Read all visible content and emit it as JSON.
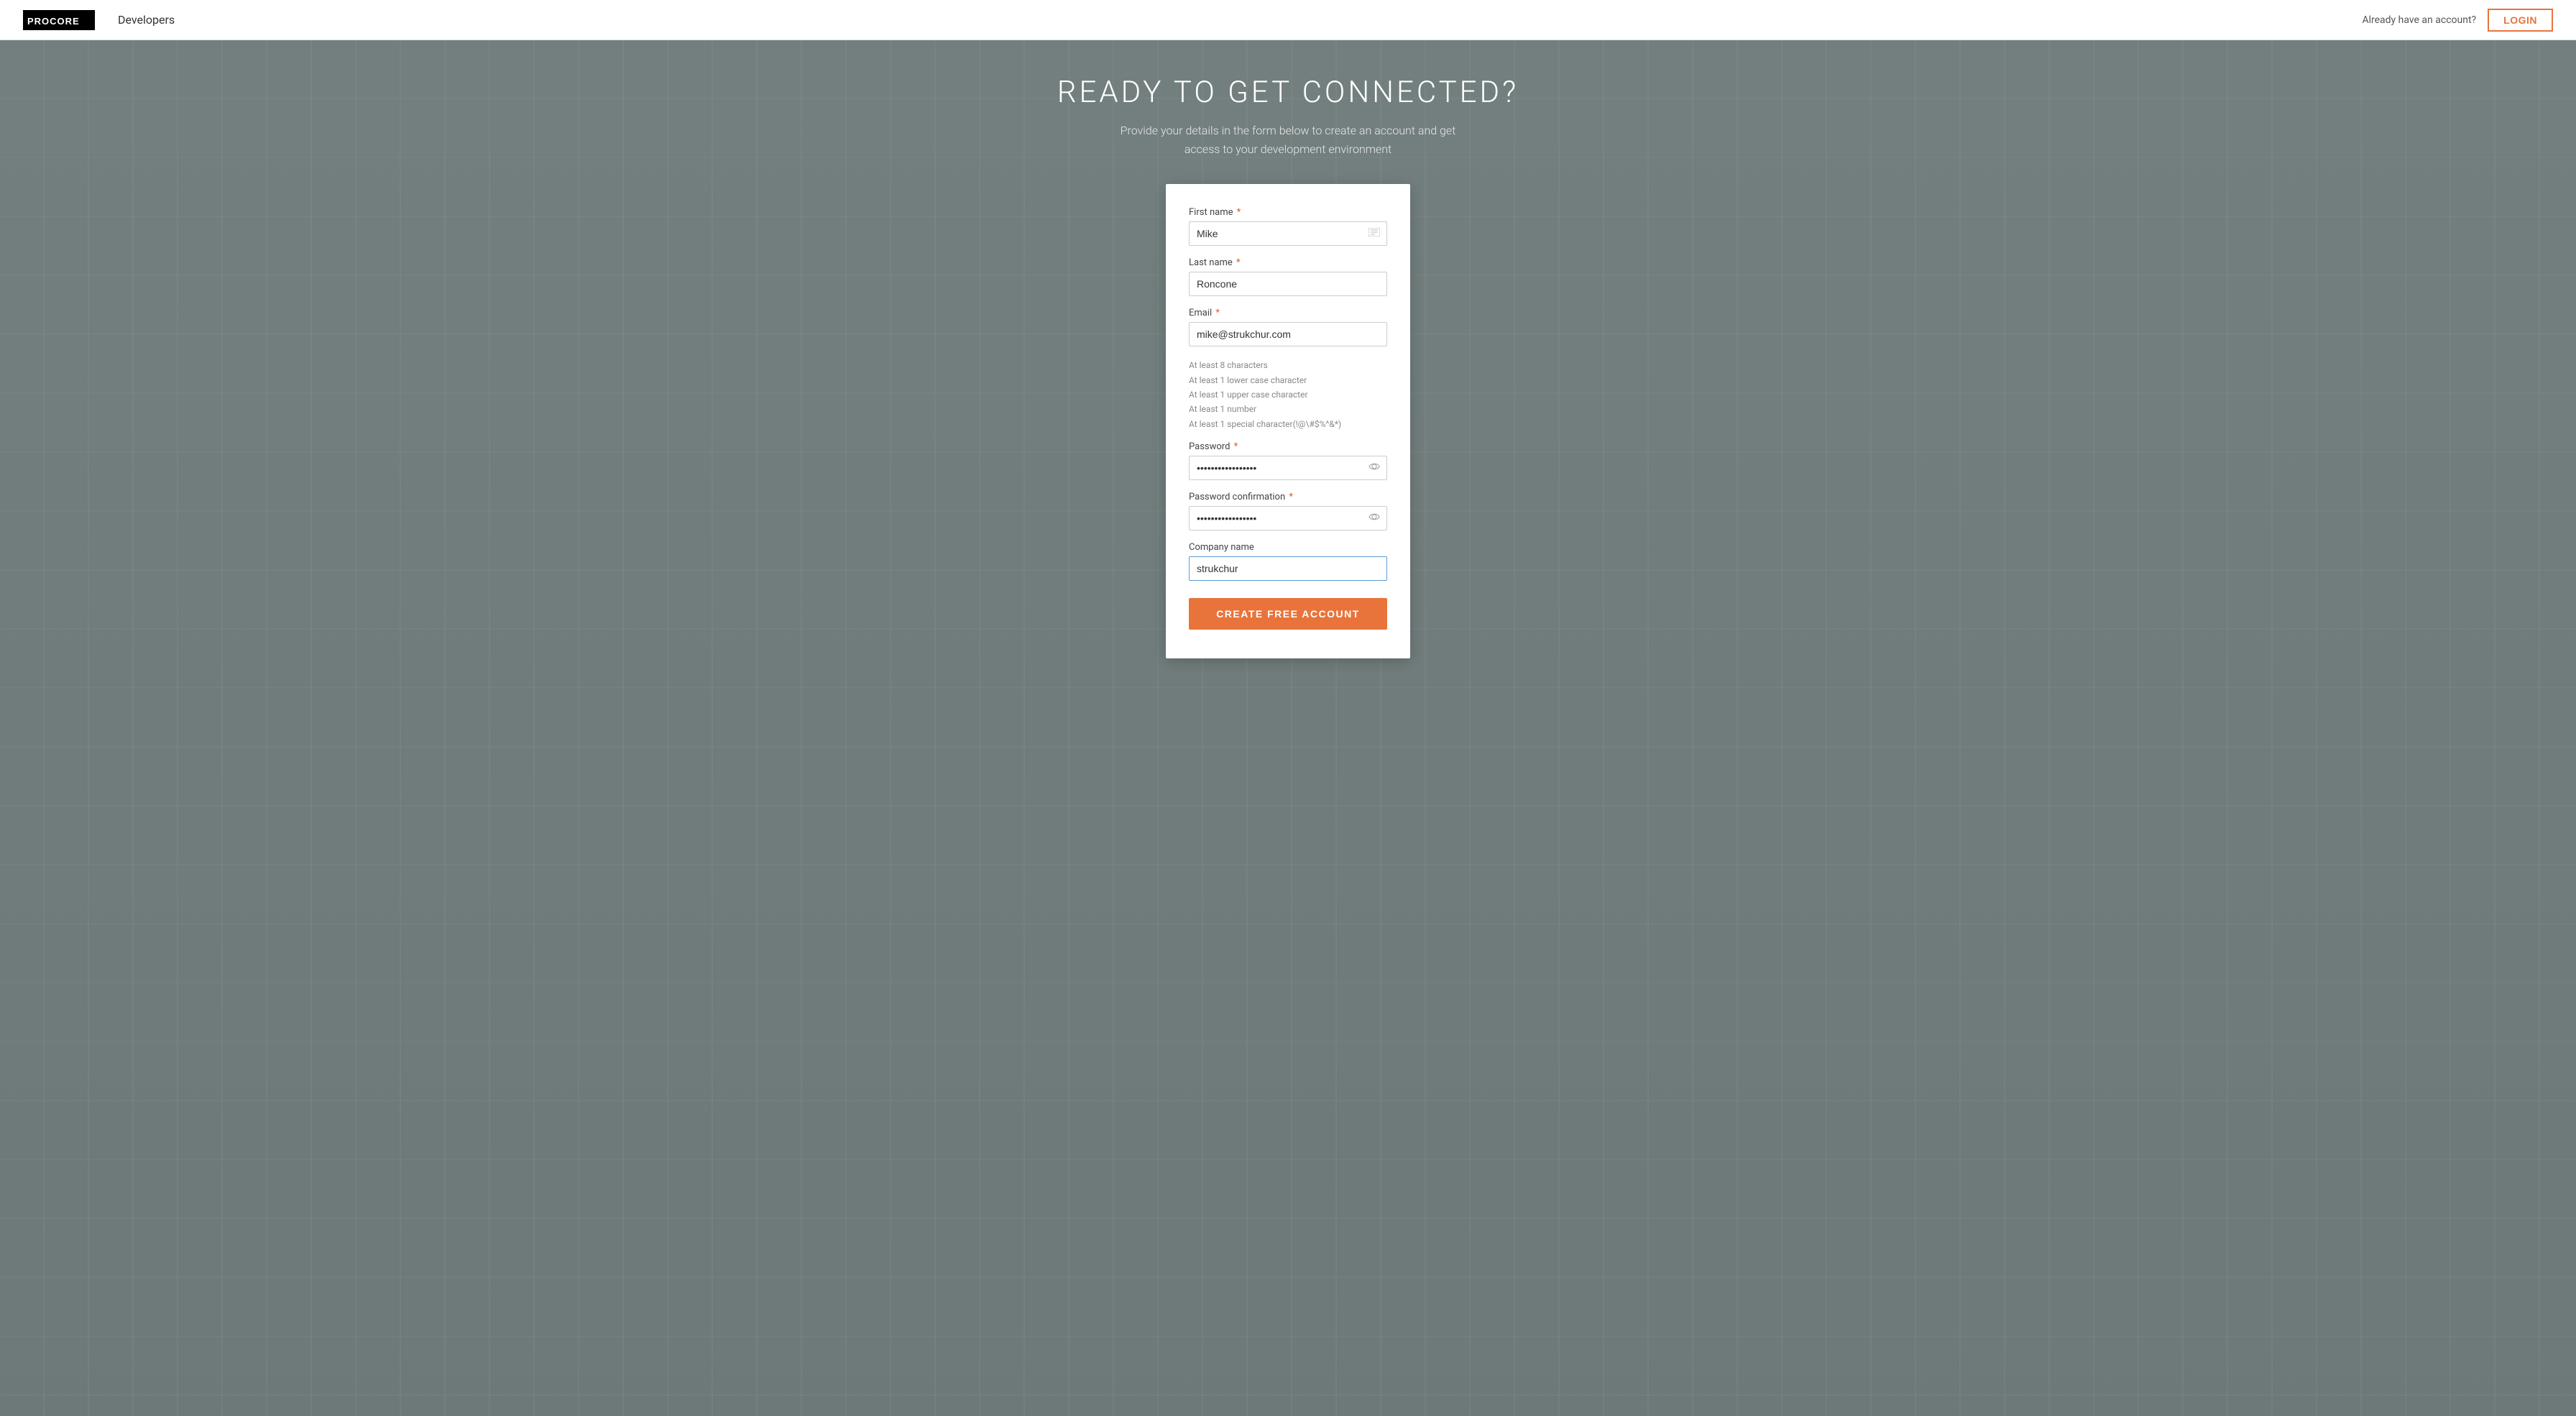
{
  "navbar": {
    "brand": {
      "wordmark": "PROCORE",
      "separator": "Developers"
    },
    "already_text": "Already have an account?",
    "login_label": "LOGIN"
  },
  "hero": {
    "title": "READY TO GET CONNECTED?",
    "subtitle": "Provide your details in the form below to create an account and get access to your development environment"
  },
  "form": {
    "first_name_label": "First name",
    "first_name_value": "Mike",
    "last_name_label": "Last name",
    "last_name_value": "Roncone",
    "email_label": "Email",
    "email_value": "mike@strukchur.com",
    "password_hints": {
      "h1": "At least 8 characters",
      "h2": "At least 1 lower case character",
      "h3": "At least 1 upper case character",
      "h4": "At least 1 number",
      "h5": "At least 1 special character(!@\\#$%^&*)"
    },
    "password_label": "Password",
    "password_dots": "••••••••••••••••••••••••••",
    "password_confirm_label": "Password confirmation",
    "password_confirm_dots": "••••••••••••••••••••••••••",
    "company_label": "Company name",
    "company_value": "strukchur",
    "submit_label": "CREATE FREE ACCOUNT",
    "required_marker": "*"
  },
  "colors": {
    "accent": "#e8743b",
    "login_border": "#e8743b",
    "required": "#e05a2b",
    "active_border": "#5b9bd5"
  }
}
